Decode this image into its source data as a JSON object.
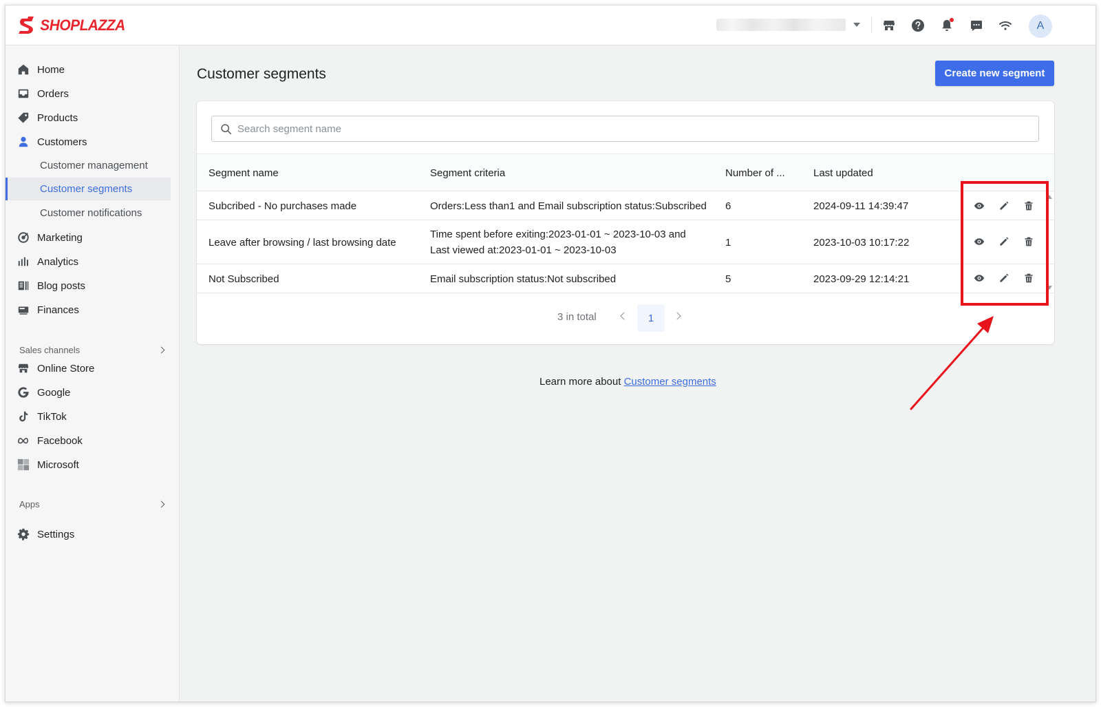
{
  "brand": {
    "name": "SHOPLAZZA"
  },
  "topbar": {
    "icons": [
      "store-icon",
      "help-icon",
      "bell-icon",
      "chat-icon",
      "wifi-icon"
    ],
    "avatar_initial": "A"
  },
  "sidebar": {
    "items": [
      {
        "label": "Home",
        "icon": "home-icon"
      },
      {
        "label": "Orders",
        "icon": "inbox-icon"
      },
      {
        "label": "Products",
        "icon": "tag-icon"
      },
      {
        "label": "Customers",
        "icon": "person-icon"
      }
    ],
    "customer_sub": [
      {
        "label": "Customer management"
      },
      {
        "label": "Customer segments",
        "active": true
      },
      {
        "label": "Customer notifications"
      }
    ],
    "items2": [
      {
        "label": "Marketing",
        "icon": "target-icon"
      },
      {
        "label": "Analytics",
        "icon": "bar-chart-icon"
      },
      {
        "label": "Blog posts",
        "icon": "blog-icon"
      },
      {
        "label": "Finances",
        "icon": "finance-icon"
      }
    ],
    "sales_channels_label": "Sales channels",
    "channels": [
      {
        "label": "Online Store",
        "icon": "store-icon"
      },
      {
        "label": "Google",
        "icon": "google-icon"
      },
      {
        "label": "TikTok",
        "icon": "tiktok-icon"
      },
      {
        "label": "Facebook",
        "icon": "meta-icon"
      },
      {
        "label": "Microsoft",
        "icon": "microsoft-icon"
      }
    ],
    "apps_label": "Apps",
    "settings_label": "Settings"
  },
  "main": {
    "title": "Customer segments",
    "create_button": "Create new segment",
    "search_placeholder": "Search segment name",
    "columns": [
      "Segment name",
      "Segment criteria",
      "Number of ...",
      "Last updated"
    ],
    "rows": [
      {
        "name": "Subcribed - No purchases made",
        "criteria": [
          "Orders:Less than1 and Email subscription status:Subscribed"
        ],
        "count": "6",
        "updated": "2024-09-11 14:39:47"
      },
      {
        "name": "Leave after browsing / last browsing date",
        "criteria": [
          "Time spent before exiting:2023-01-01 ~ 2023-10-03 and",
          "Last viewed at:2023-01-01 ~ 2023-10-03"
        ],
        "count": "1",
        "updated": "2023-10-03 10:17:22"
      },
      {
        "name": "Not Subscribed",
        "criteria": [
          "Email subscription status:Not subscribed"
        ],
        "count": "5",
        "updated": "2023-09-29 12:14:21"
      }
    ],
    "row_actions": [
      "eye-icon",
      "pencil-icon",
      "trash-icon"
    ],
    "pagination": {
      "total_text": "3 in total",
      "current_page": "1"
    },
    "learn_more_text": "Learn more about",
    "learn_more_link": "Customer segments"
  },
  "colors": {
    "accent": "#3d6de8",
    "brand_red": "#e8242d",
    "annotation_red": "#e8141c"
  }
}
